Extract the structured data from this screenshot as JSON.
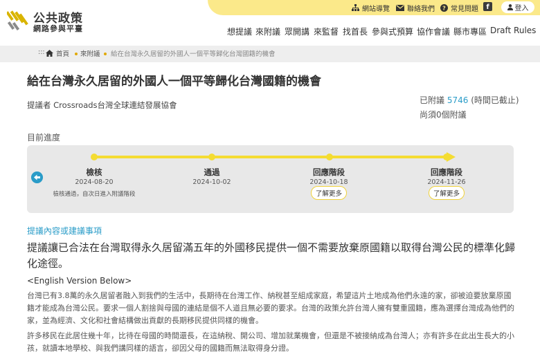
{
  "site": {
    "title": "公共政策",
    "subtitle": "網路參與平臺"
  },
  "utility": {
    "sitemap": "網站導覽",
    "contact": "聯絡我們",
    "faq": "常見問題",
    "facebook": "f",
    "login": "登入"
  },
  "nav": [
    "想提議",
    "來附議",
    "眾開講",
    "來監督",
    "找首長",
    "參與式預算",
    "協作會議",
    "縣市專區",
    "Draft Rules"
  ],
  "breadcrumb": {
    "dots": ":::",
    "home": "首頁",
    "level2": "來附議",
    "current": "給在台灣永久居留的外國人一個平等歸化台灣國籍的機會"
  },
  "proposal": {
    "title": "給在台灣永久居留的外國人一個平等歸化台灣國籍的機會",
    "proposer": "提議者 Crossroads台灣全球連結發展協會",
    "count_prefix": "已附議",
    "count": "5746",
    "count_suffix": "(時間已截止)",
    "need": "尚須0個附議"
  },
  "progress": {
    "label": "目前進度",
    "steps": [
      {
        "name": "檢核",
        "date": "2024-08-20",
        "note": "檢核通過，自次日進入附議階段"
      },
      {
        "name": "通過",
        "date": "2024-10-02"
      },
      {
        "name": "回應階段",
        "date": "2024-10-18",
        "button": "了解更多"
      },
      {
        "name": "回應階段",
        "date": "2024-11-26",
        "button": "了解更多"
      }
    ]
  },
  "content": {
    "section": "提議內容或建議事項",
    "summary": "提議讓已合法在台灣取得永久居留滿五年的外國移民提供一個不需要放棄原國籍以取得台灣公民的標準化歸化途徑。",
    "english_note": "<English Version Below>",
    "para1": "台灣已有3.8萬的永久居留者融入到我們的生活中，長期待在台灣工作、納稅甚至組成家庭，希望這片土地成為他們永遠的家，卻被迫要放棄原國籍才能成為台灣公民。要求一個人割捨與母國的連結是個不人道且無必要的要求。台灣的政策允許台灣人擁有雙重國籍，應為選擇台灣成為他們的家，並為經濟、文化和社會結構做出貢獻的長期移民提供同樣的機會。",
    "para2": "許多移民在此居住幾十年，比待在母國的時間還長，在這納稅、開公司、增加就業機會，但還是不被接納成為台灣人；亦有許多在此出生長大的小孩，就讀本地學校、與我們講同樣的語言，卻因父母的國籍而無法取得身分證。"
  },
  "colors": {
    "accent": "#2a9cc8",
    "brand_yellow": "#f4dc32",
    "header_band": "#fbe98a"
  }
}
